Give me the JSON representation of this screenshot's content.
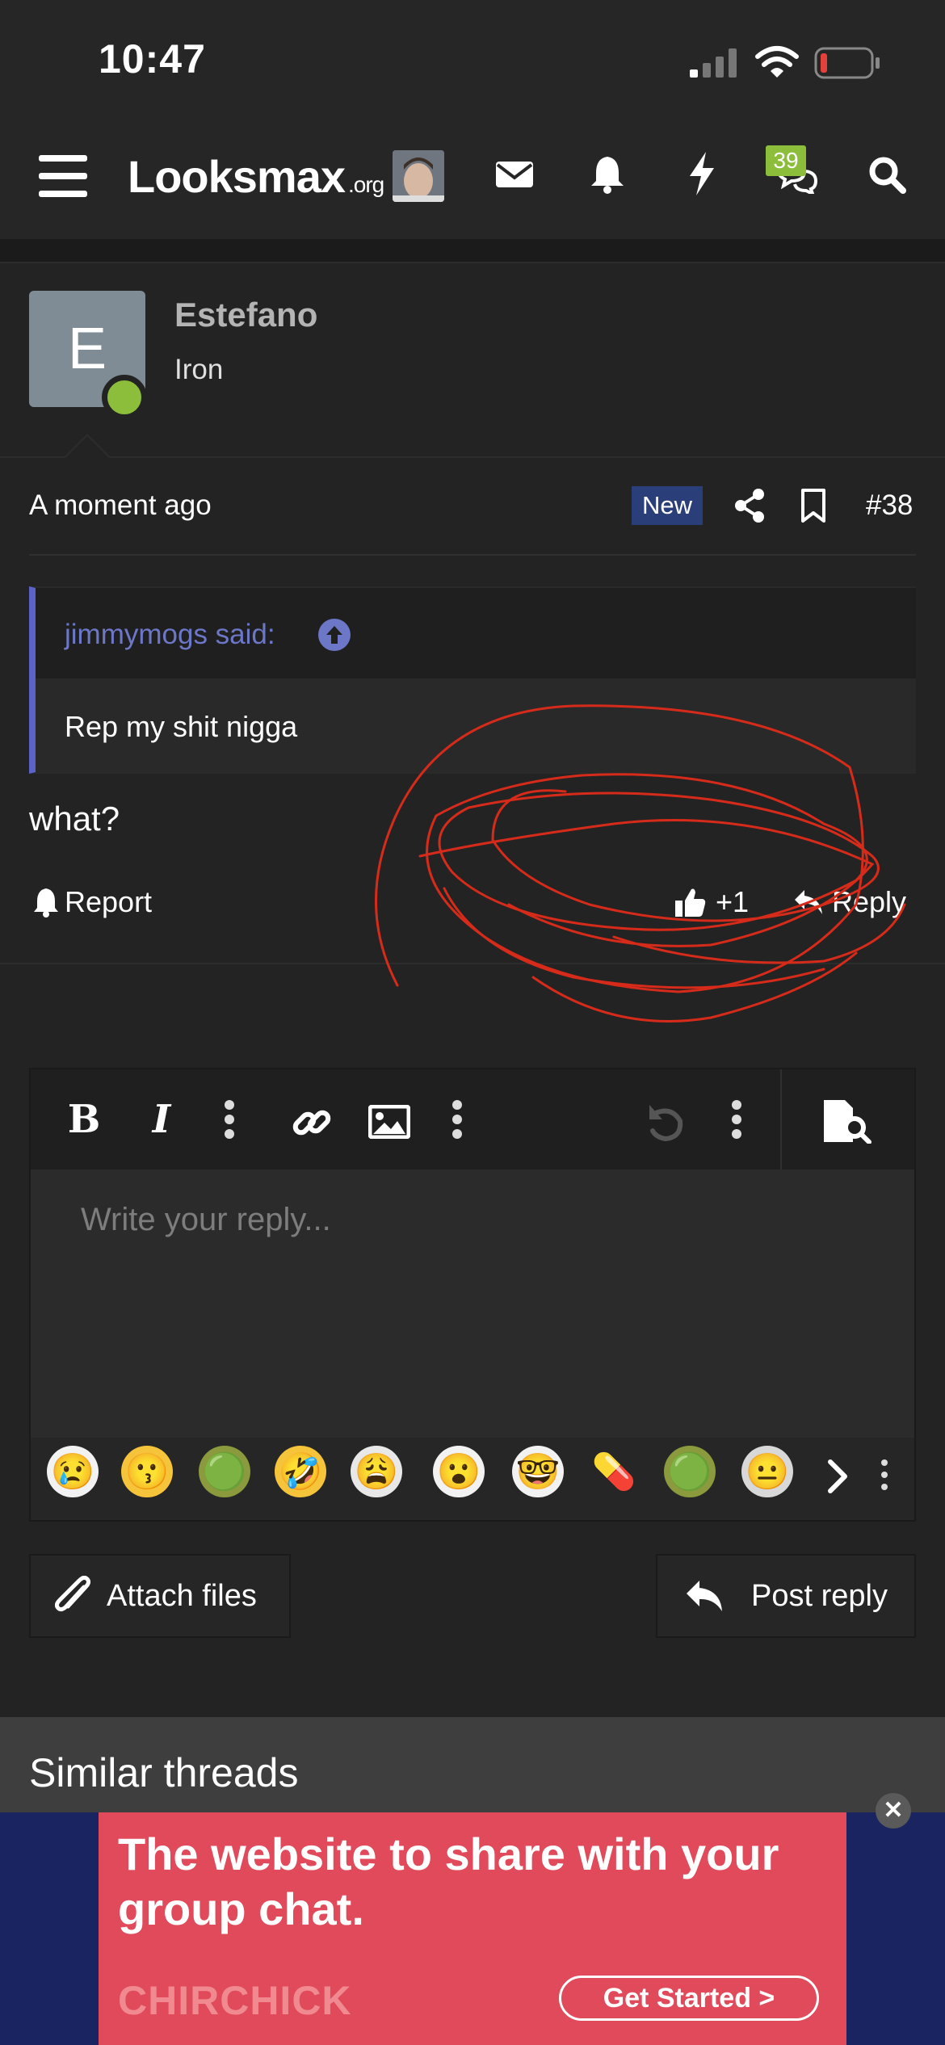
{
  "status_bar": {
    "time": "10:47"
  },
  "header": {
    "logo_main": "Looksmax",
    "logo_tld": ".org",
    "chat_badge_count": "39",
    "icons": [
      "menu-icon",
      "avatar",
      "mail-icon",
      "bell-icon",
      "bolt-icon",
      "chat-icon",
      "search-icon"
    ]
  },
  "post": {
    "avatar_letter": "E",
    "username": "Estefano",
    "user_title": "Iron",
    "time": "A moment ago",
    "new_badge": "New",
    "number": "#38",
    "quote": {
      "author": "jimmymogs said:",
      "text": "Rep my shit nigga"
    },
    "body": "what?",
    "actions": {
      "report": "Report",
      "like_count": "+1",
      "reply": "Reply"
    }
  },
  "editor": {
    "toolbar": {
      "bold": "B",
      "italic": "I"
    },
    "placeholder": "Write your reply...",
    "emojis": [
      "😢",
      "😗",
      "🟢",
      "🤣",
      "😩",
      "😮",
      "🤓",
      "💊",
      "🟢",
      "😐"
    ]
  },
  "buttons": {
    "attach": "Attach files",
    "post_reply": "Post reply"
  },
  "similar": {
    "title": "Similar threads"
  },
  "ad": {
    "headline": "The website to share with your group chat.",
    "brand": "CHIRCHICK",
    "cta": "Get Started  >",
    "close": "✕"
  },
  "colors": {
    "background": "#232323",
    "accent_green": "#8cbe3c",
    "quote_accent": "#5a64c8",
    "new_badge": "#2a3f7a",
    "ad_pink": "#e04a5b",
    "ad_navy": "#1a2461",
    "scribble_red": "#d62b1a"
  }
}
